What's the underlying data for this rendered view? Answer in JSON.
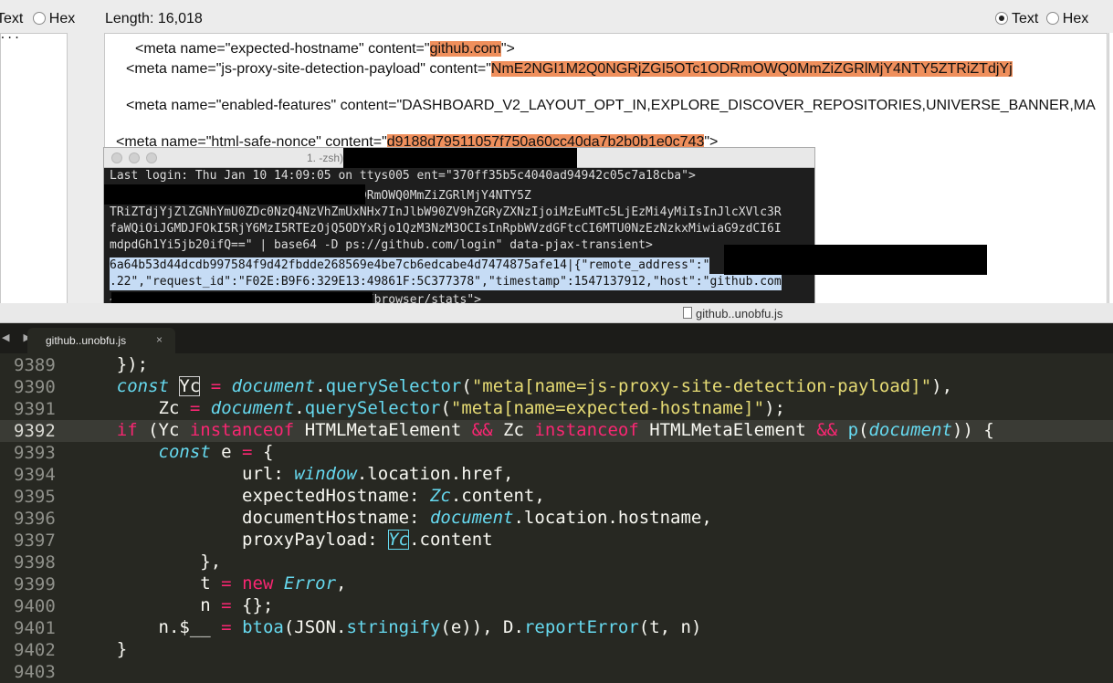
{
  "inspector": {
    "left_tabs": {
      "text": "Text",
      "hex": "Hex"
    },
    "left_fragment": "...",
    "length_label": "Length: 16,018",
    "right_tabs": {
      "text": "Text",
      "hex": "Hex",
      "selected": "Text"
    },
    "lines": [
      {
        "pre": "<meta name=\"expected-hostname\" content=\"",
        "hl": "github.com",
        "post": "\">"
      },
      {
        "pre": "<meta name=\"js-proxy-site-detection-payload\" content=\"",
        "hl": "NmE2NGI1M2Q0NGRjZGI5OTc1ODRmOWQ0MmZiZGRlMjY4NTY5ZTRiZTdjYj",
        "post": ""
      },
      {
        "pre": "<meta name=\"enabled-features\" content=\"DASHBOARD_V2_LAYOUT_OPT_IN,EXPLORE_DISCOVER_REPOSITORIES,UNIVERSE_BANNER,MA",
        "hl": "",
        "post": ""
      },
      {
        "pre": "<meta name=\"html-safe-nonce\" content=\"",
        "hl": "d9188d79511057f750a60cc40da7b2b0b1e0c743",
        "post": "\">"
      }
    ]
  },
  "terminal": {
    "title": "1.                              -zsh)",
    "lines": [
      "Last login: Thu Jan 10 14:09:05 on ttys005    ent=\"370ff35b5c4040ad94942c05c7a18cba\">",
      "                                 ~ % echo \"NmE2NGI1M2Q0NGRjZGI5OTc1ODRmOWQ0MmZiZGRlMjY4NTY5Z",
      "TRiZTdjYjZlZGNhYmU0ZDc0NzQ4NzVhZmUxNHx7InJlbW90ZV9hZGRyZXNzIjoiMzEuMTc5LjEzMi4yMiIsInJlcXVlc3R",
      "faWQiOiJGMDJFOkI5RjY6MzI5RTEzOjQ5ODYxRjo1QzM3NzM3OCIsInRpbWVzdGFtcCI6MTU0NzEzNzkxMiwiaG9zdCI6I",
      "mdpdGh1Yi5jb20ifQ==\" | base64 -D      ps://github.com/login\" data-pjax-transient>",
      "6a64b53d44dcdb997584f9d42fbdde268569e4be7cb6edcabe4d7474875afe14|{\"remote_address\":\"",
      ".22\",\"request_id\":\"F02E:B9F6:329E13:49861F:5C377378\",\"timestamp\":1547137912,\"host\":\"github.com",
      "                                 ~ %  \"https://api.github.com/_private/browser/stats\">"
    ]
  },
  "editor": {
    "window_title": "github..unobfu.js",
    "tab_label": "github..unobfu.js",
    "tab_close": "×",
    "nav": "◀ ▶",
    "current_line": 9392,
    "gutter": [
      "9389",
      "9390",
      "9391",
      "9392",
      "9393",
      "9394",
      "9395",
      "9396",
      "9397",
      "9398",
      "9399",
      "9400",
      "9401",
      "9402",
      "9403"
    ]
  },
  "colors": {
    "highlight": "#ef8f5c",
    "editor_bg": "#272822",
    "keyword": "#f92672",
    "storage": "#66d9ef",
    "string": "#e6db74"
  }
}
